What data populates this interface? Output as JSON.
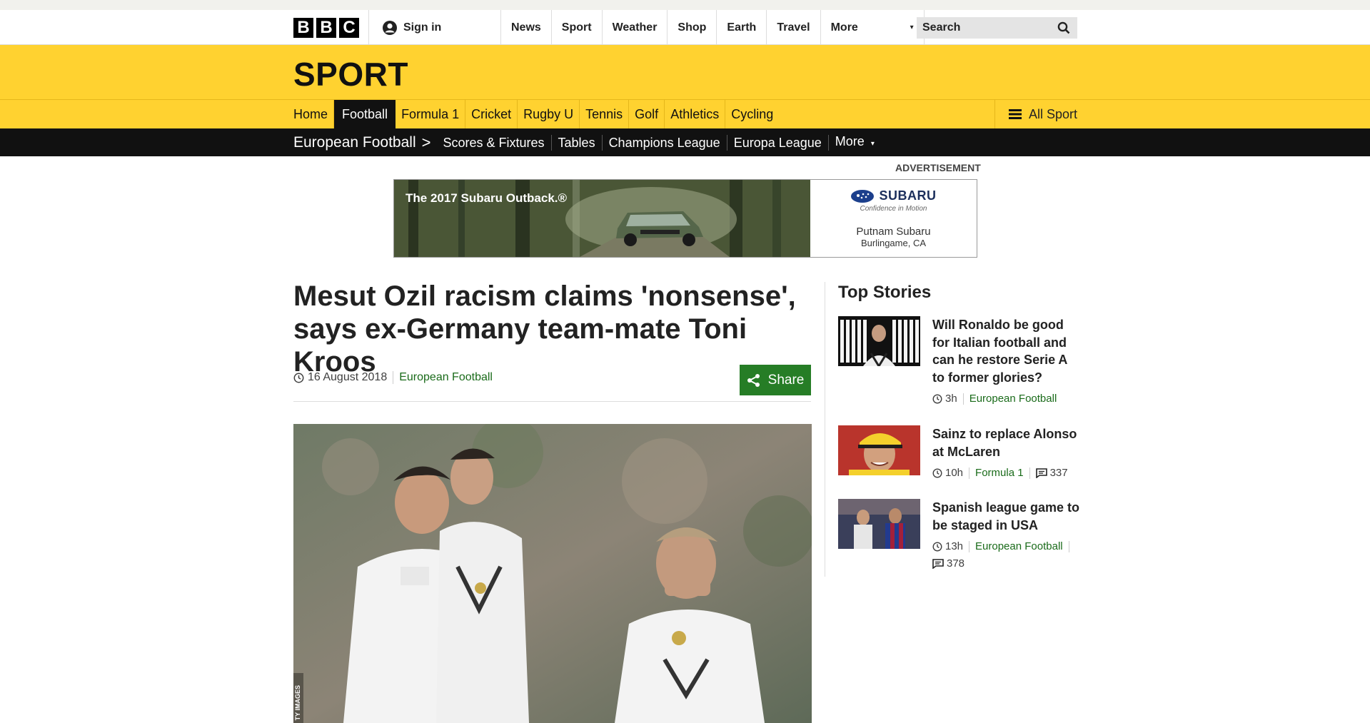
{
  "masthead": {
    "logo_letters": [
      "B",
      "B",
      "C"
    ],
    "signin_label": "Sign in",
    "nav": [
      "News",
      "Sport",
      "Weather",
      "Shop",
      "Earth",
      "Travel"
    ],
    "more_label": "More",
    "search_placeholder": "Search"
  },
  "sport": {
    "title": "SPORT",
    "nav": [
      "Home",
      "Football",
      "Formula 1",
      "Cricket",
      "Rugby U",
      "Tennis",
      "Golf",
      "Athletics",
      "Cycling"
    ],
    "active": "Football",
    "all_sport_label": "All Sport"
  },
  "subnav": {
    "section": "European Football",
    "chevron": ">",
    "links": [
      "Scores & Fixtures",
      "Tables",
      "Champions League",
      "Europa League",
      "More"
    ]
  },
  "ad": {
    "label": "ADVERTISEMENT",
    "tagline": "The 2017 Subaru Outback.®",
    "brand": "SUBARU",
    "brand_tag": "Confidence in Motion",
    "dealer": "Putnam Subaru",
    "dealer_location": "Burlingame, CA"
  },
  "article": {
    "headline": "Mesut Ozil racism claims 'nonsense', says ex-Germany team-mate Toni Kroos",
    "date": "16 August 2018",
    "section": "European Football",
    "share_label": "Share",
    "image_credit": "TY IMAGES"
  },
  "top_stories": {
    "title": "Top Stories",
    "stories": [
      {
        "title": "Will Ronaldo be good for Italian football and can he restore Serie A to former glories?",
        "age": "3h",
        "section": "European Football",
        "comments": ""
      },
      {
        "title": "Sainz to replace Alonso at McLaren",
        "age": "10h",
        "section": "Formula 1",
        "comments": "337"
      },
      {
        "title": "Spanish league game to be staged in USA",
        "age": "13h",
        "section": "European Football",
        "comments": "378"
      }
    ]
  },
  "colors": {
    "sport_yellow": "#ffd230",
    "link_green": "#1a6b1a",
    "share_green": "#267d26"
  }
}
